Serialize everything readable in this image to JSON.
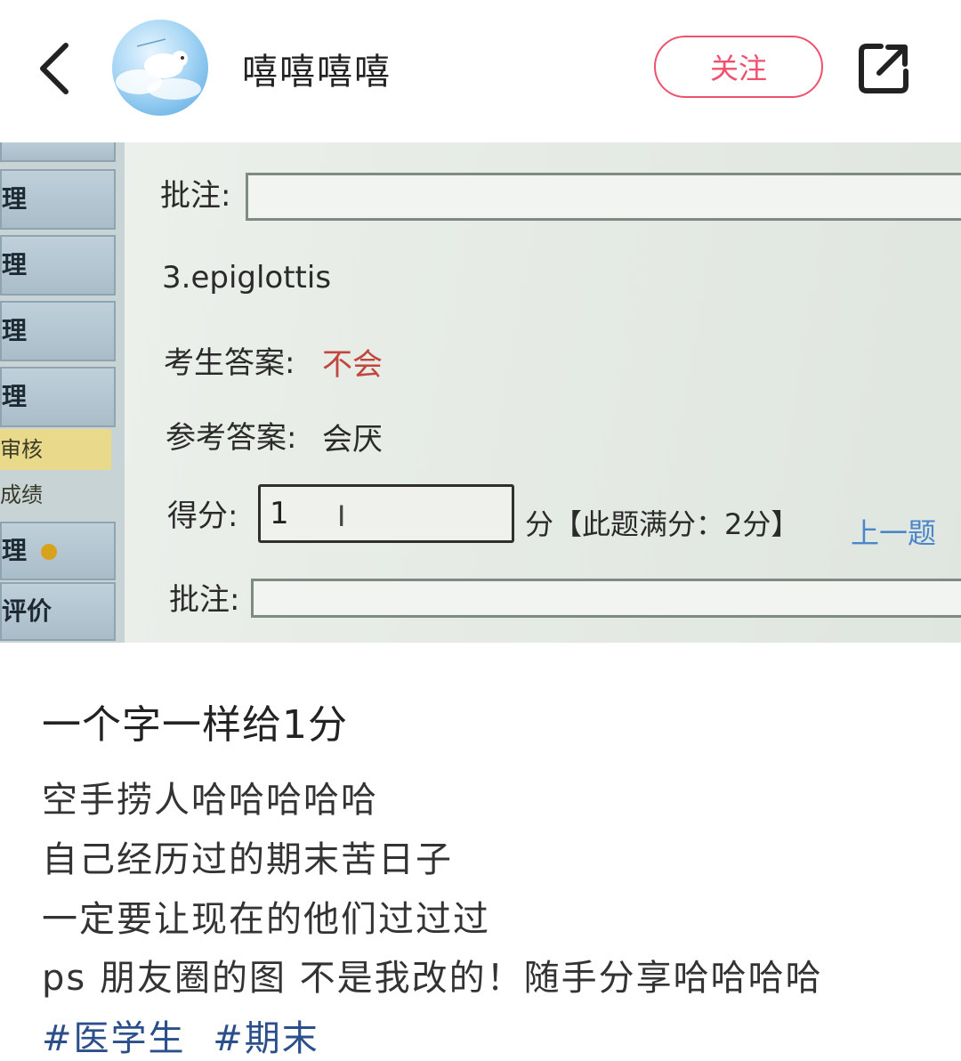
{
  "header": {
    "username": "嘻嘻嘻嘻",
    "follow_label": "关注"
  },
  "photo": {
    "sidebar_items": [
      "理",
      "理",
      "理",
      "理",
      "审核",
      "成绩",
      "理",
      "评价"
    ],
    "annotation_label_1": "批注:",
    "question": "3.epiglottis",
    "student_answer_label": "考生答案:",
    "student_answer": "不会",
    "reference_answer_label": "参考答案:",
    "reference_answer": "会厌",
    "score_label": "得分:",
    "score_value": "1",
    "score_suffix": "分【此题满分：2分】",
    "prev_link": "上一题",
    "annotation_label_2": "批注:"
  },
  "post": {
    "title": "一个字一样给1分",
    "lines": [
      "空手捞人哈哈哈哈哈",
      "自己经历过的期末苦日子",
      "一定要让现在的他们过过过",
      "ps 朋友圈的图 不是我改的！随手分享哈哈哈哈"
    ],
    "tags": [
      "#医学生",
      "#期末"
    ]
  },
  "colors": {
    "accent": "#f0506e",
    "tag": "#2b4f8a"
  }
}
